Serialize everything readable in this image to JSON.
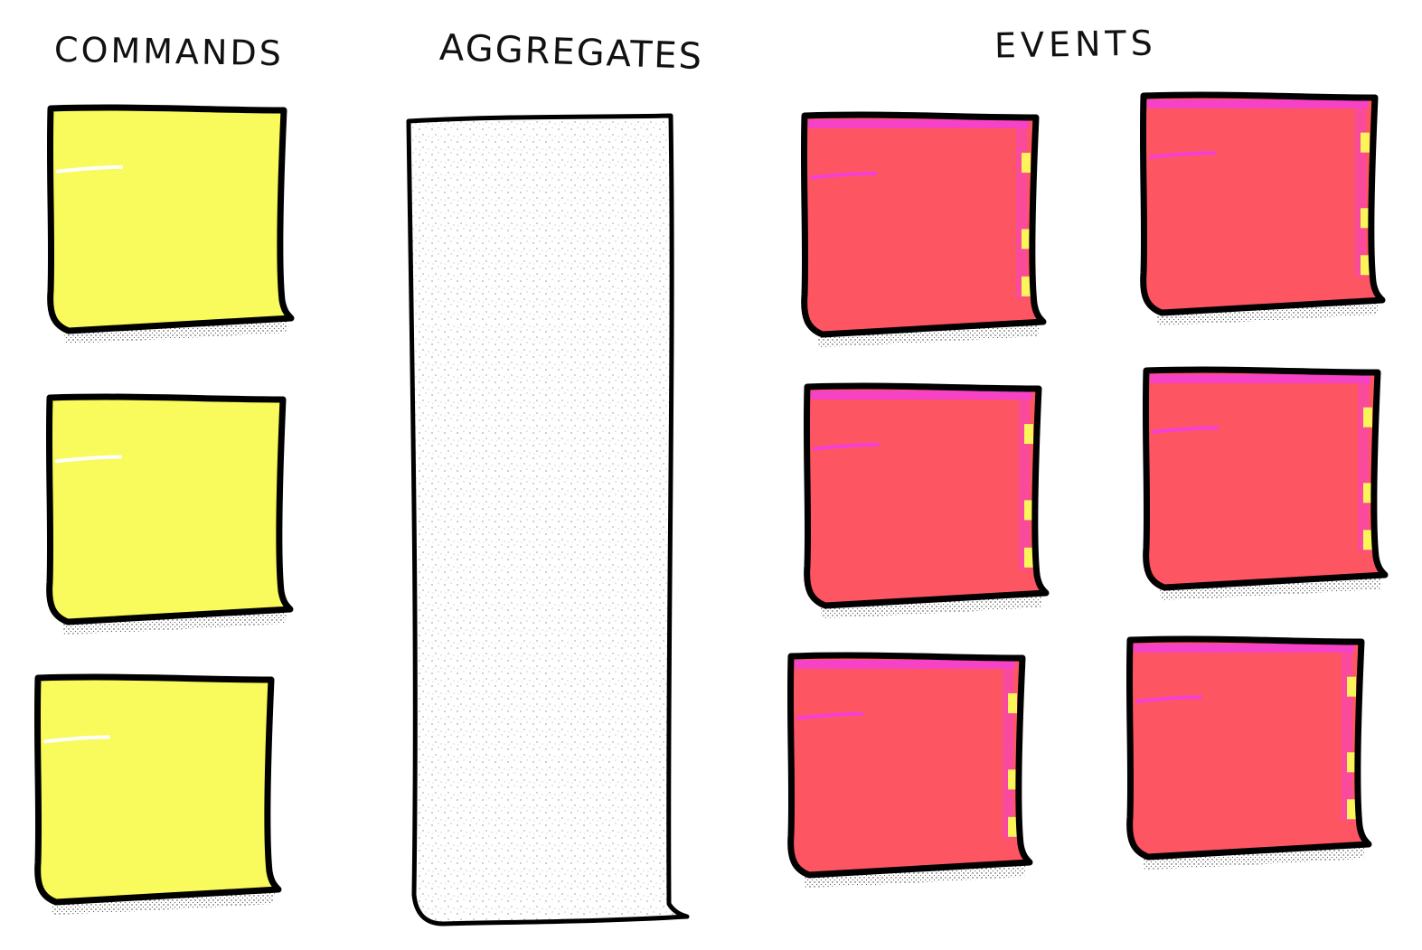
{
  "columns": {
    "commands": {
      "heading": "COMMANDS",
      "note_count": 3,
      "note_color": "#f9fa5c",
      "highlight_color": "#fdfde0"
    },
    "aggregates": {
      "heading": "AGGREGATES",
      "note_color": "#ffffff"
    },
    "events": {
      "heading": "EVENTS",
      "note_count": 6,
      "note_color": "#fe5562",
      "edge_color": "#f43fd6",
      "accent_color": "#fbf55a"
    }
  },
  "outline_color": "#000000"
}
